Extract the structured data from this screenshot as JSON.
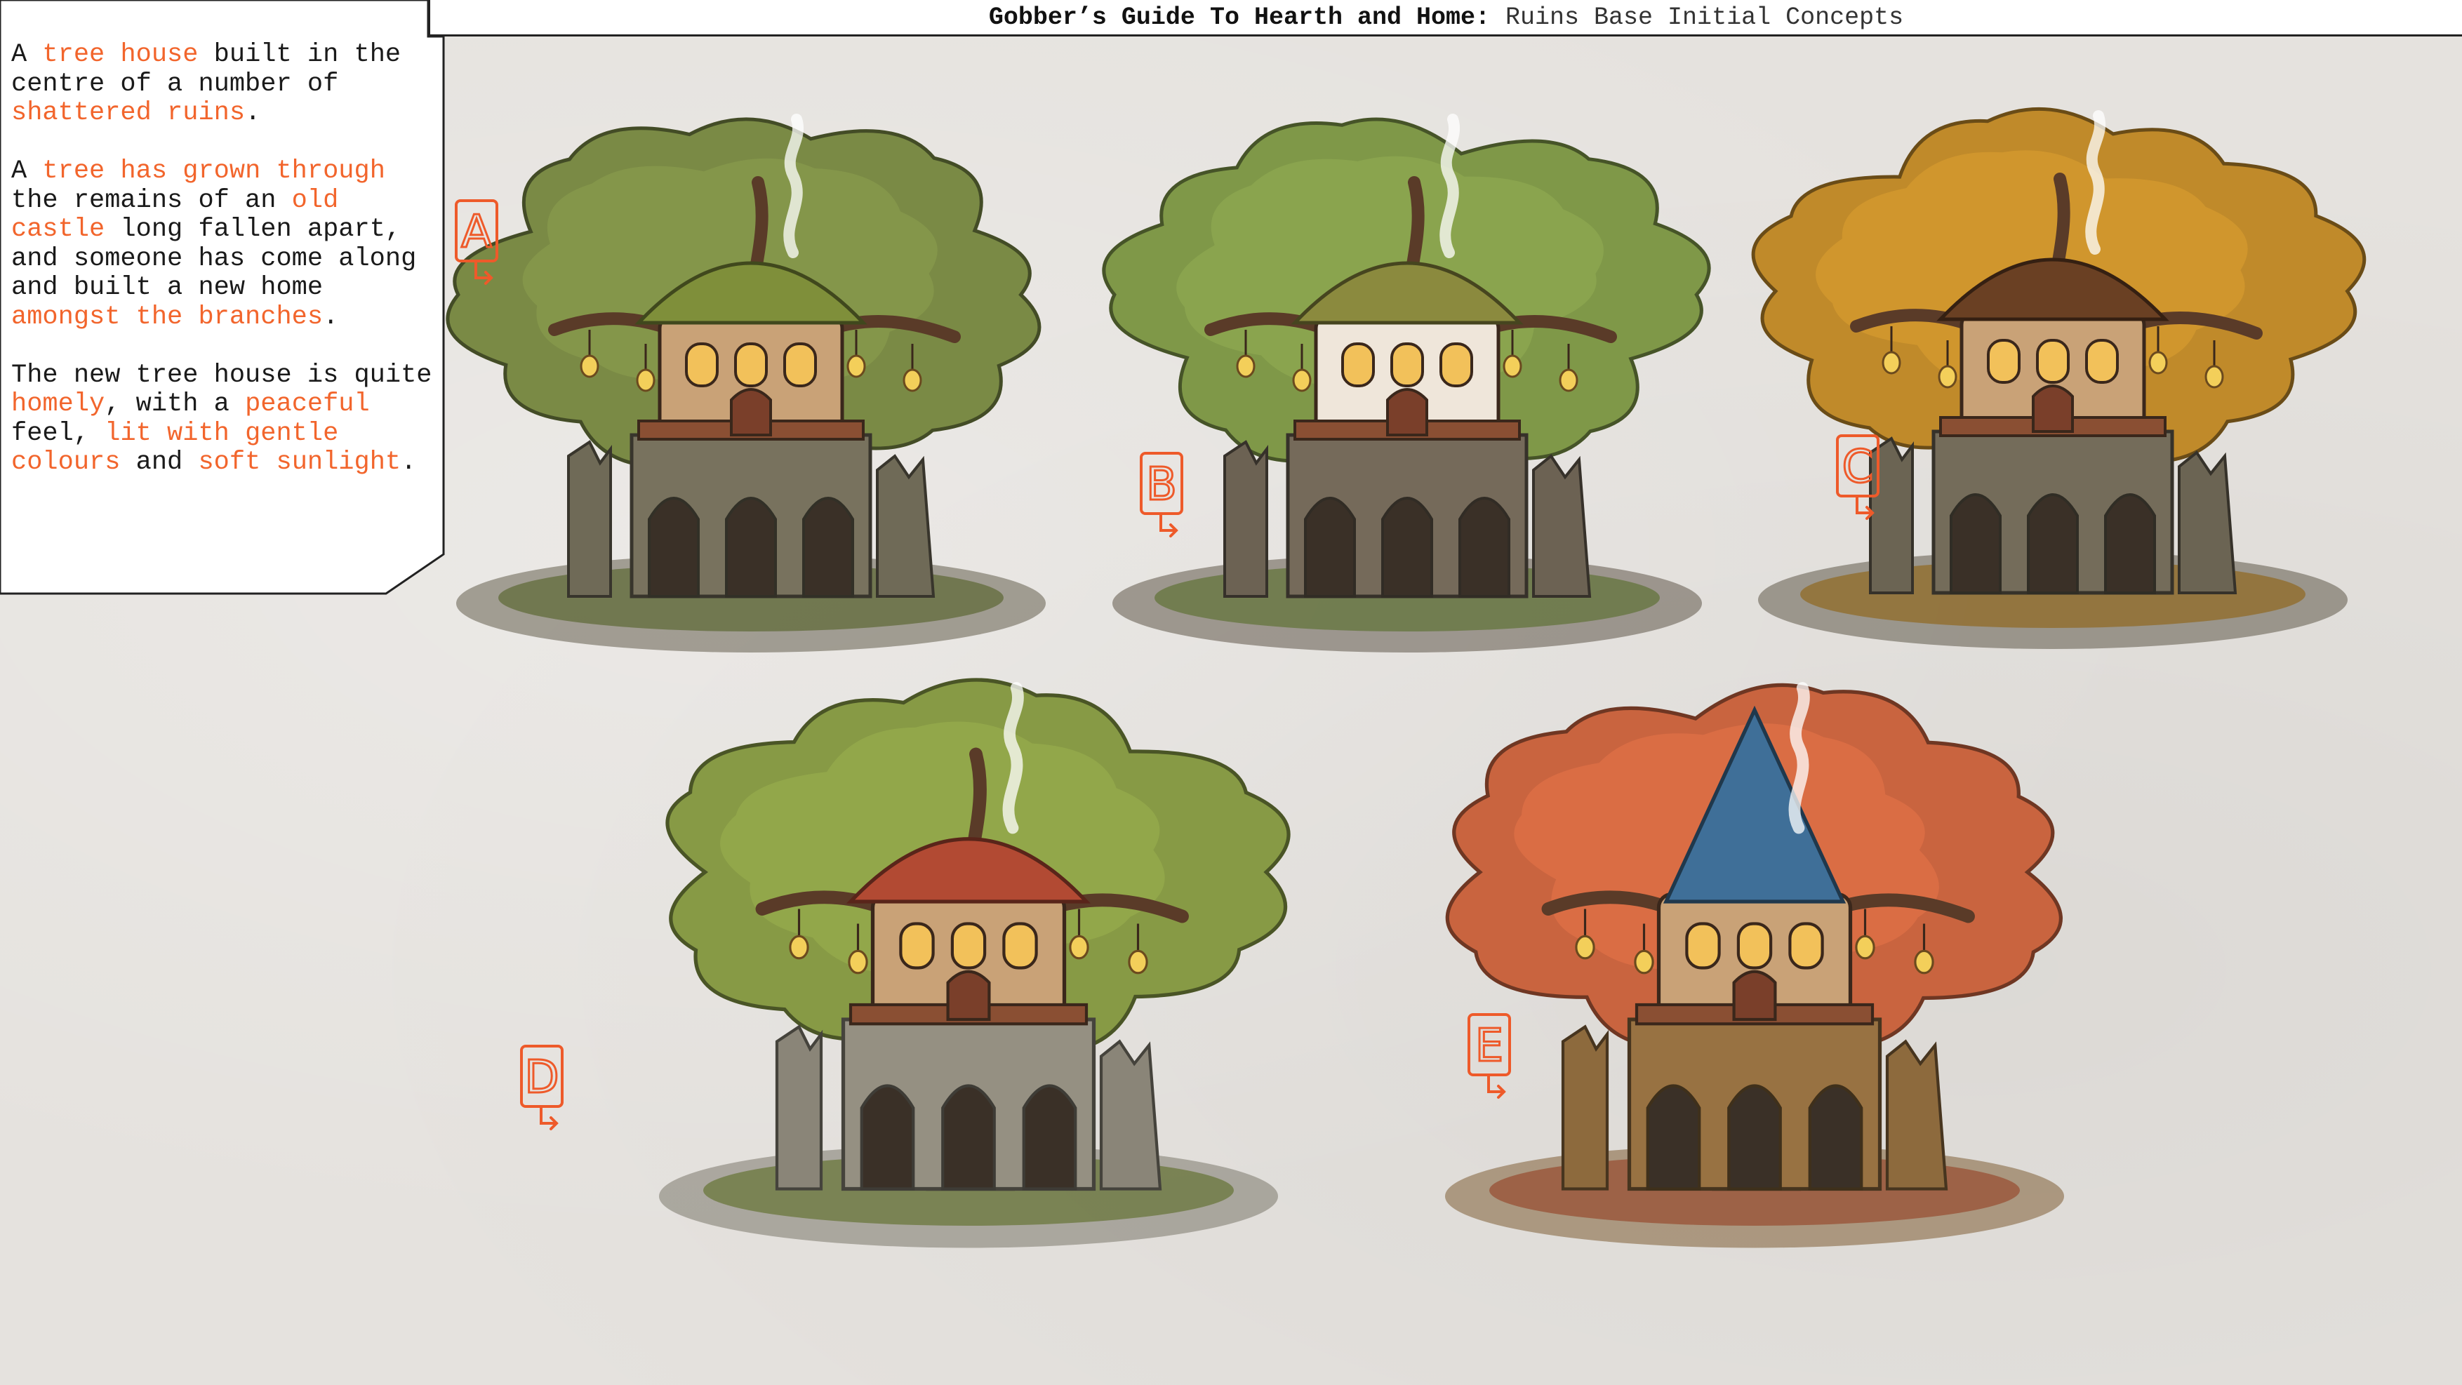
{
  "title": {
    "main": "Gobber’s Guide To Hearth and Home:",
    "sub": "Ruins Base Initial Concepts"
  },
  "description": {
    "p1": {
      "t1": "A ",
      "h1": "tree house",
      "t2": " built in the centre of a number of ",
      "h2": "shattered ruins",
      "t3": "."
    },
    "p2": {
      "t1": "A ",
      "h1": "tree has grown through",
      "t2": " the remains of an ",
      "h2": "old castle",
      "t3": " long fallen apart, and someone has come along and built a new home ",
      "h3": "amongst the branches",
      "t4": "."
    },
    "p3": {
      "t1": "The new tree house is quite ",
      "h1": "homely",
      "t2": ", with a ",
      "h2": "peaceful",
      "t3": " feel, ",
      "h3": "lit with gentle colours",
      "t4": " and ",
      "h4": "soft sunlight",
      "t5": "."
    }
  },
  "concepts": [
    {
      "label": "A",
      "canopy_color": "#7a8a45",
      "roof_color": "#7f8f3a",
      "stone_color": "#6f6a57"
    },
    {
      "label": "B",
      "canopy_color": "#7f9848",
      "roof_color": "#8b8a3e",
      "stone_color": "#6c6253"
    },
    {
      "label": "C",
      "canopy_color": "#c08a2a",
      "roof_color": "#6a4023",
      "stone_color": "#6b6453"
    },
    {
      "label": "D",
      "canopy_color": "#879a45",
      "roof_color": "#b24a33",
      "stone_color": "#8a8578"
    },
    {
      "label": "E",
      "canopy_color": "#c9643f",
      "roof_color": "#3f6f98",
      "stone_color": "#8d6a3d"
    }
  ],
  "colors": {
    "background": "#e5e2de",
    "highlight": "#f2652c",
    "text": "#1a1a1a",
    "label": "#ee5a2a"
  }
}
